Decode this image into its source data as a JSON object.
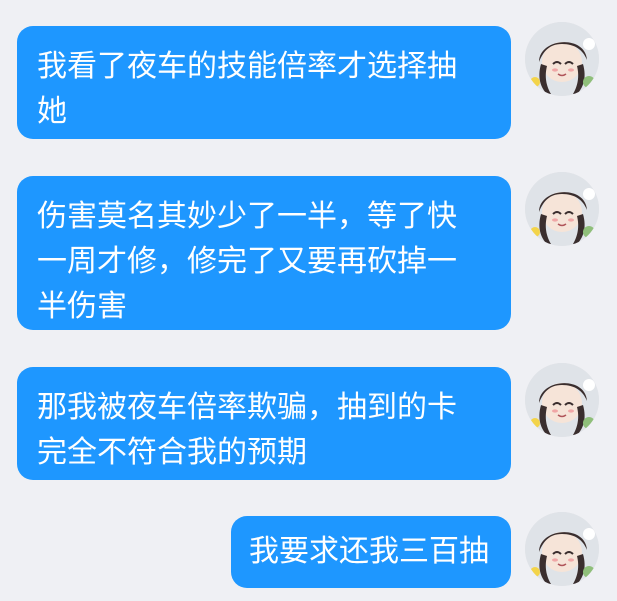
{
  "chat": {
    "messages": [
      {
        "text": "我看了夜车的技能倍率才选择抽她"
      },
      {
        "text": "伤害莫名其妙少了一半，等了快一周才修，修完了又要再砍掉一半伤害"
      },
      {
        "text": "那我被夜车倍率欺骗，抽到的卡完全不符合我的预期"
      },
      {
        "text": "我要求还我三百抽"
      }
    ]
  },
  "colors": {
    "bubble": "#1e97ff",
    "background": "#eff0f4",
    "bubble_text": "#ffffff"
  }
}
